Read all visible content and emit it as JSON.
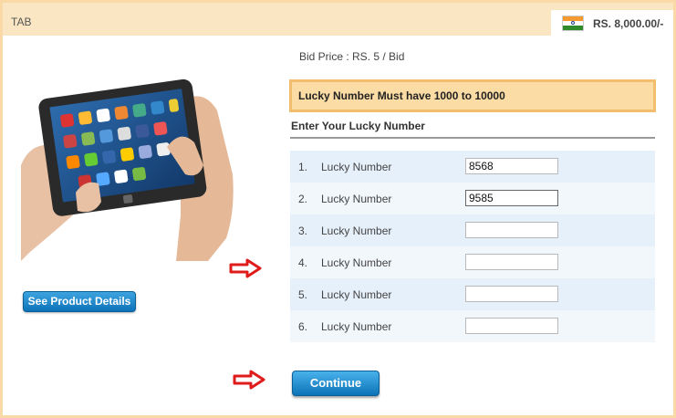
{
  "header": {
    "title": "TAB",
    "balance": "RS. 8,000.00/-",
    "flag_icon": "india-flag-icon"
  },
  "product": {
    "image_icon": "tablet-in-hands-image",
    "details_button": "See Product Details"
  },
  "bid": {
    "price_text": "Bid Price : RS. 5 / Bid",
    "notice": "Lucky Number Must have 1000 to 10000",
    "section_heading": "Enter Your Lucky Number"
  },
  "lucky_numbers": [
    {
      "index": "1.",
      "label": "Lucky Number",
      "value": "8568"
    },
    {
      "index": "2.",
      "label": "Lucky Number",
      "value": "9585"
    },
    {
      "index": "3.",
      "label": "Lucky Number",
      "value": ""
    },
    {
      "index": "4.",
      "label": "Lucky Number",
      "value": ""
    },
    {
      "index": "5.",
      "label": "Lucky Number",
      "value": ""
    },
    {
      "index": "6.",
      "label": "Lucky Number",
      "value": ""
    }
  ],
  "actions": {
    "continue_label": "Continue"
  },
  "colors": {
    "header_bg": "#fbe6c3",
    "notice_bg": "#fbdca4",
    "button_blue": "#0c73b8",
    "arrow_red": "#e01b1b"
  }
}
